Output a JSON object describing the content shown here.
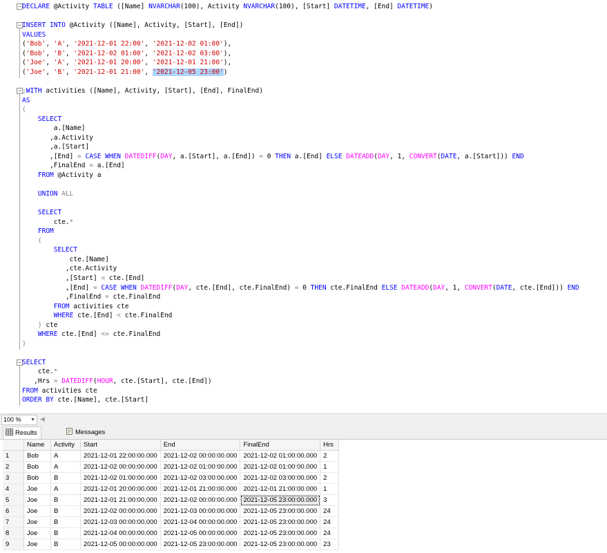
{
  "editor": {
    "lines": [
      {
        "t": [
          {
            "c": "kw",
            "s": "DECLARE"
          },
          {
            "s": " @Activity "
          },
          {
            "c": "kw",
            "s": "TABLE"
          },
          {
            "s": " ([Name] "
          },
          {
            "c": "kw",
            "s": "NVARCHAR"
          },
          {
            "s": "(100), Activity "
          },
          {
            "c": "kw",
            "s": "NVARCHAR"
          },
          {
            "s": "(100), [Start] "
          },
          {
            "c": "kw",
            "s": "DATETIME"
          },
          {
            "s": ", [End] "
          },
          {
            "c": "kw",
            "s": "DATETIME"
          },
          {
            "s": ")"
          }
        ]
      },
      {
        "t": []
      },
      {
        "t": [
          {
            "c": "kw",
            "s": "INSERT INTO"
          },
          {
            "s": " @Activity ([Name], Activity, [Start], [End])"
          }
        ]
      },
      {
        "t": [
          {
            "c": "kw",
            "s": "VALUES"
          }
        ]
      },
      {
        "t": [
          {
            "s": "("
          },
          {
            "c": "str",
            "s": "'Bob'"
          },
          {
            "s": ", "
          },
          {
            "c": "str",
            "s": "'A'"
          },
          {
            "s": ", "
          },
          {
            "c": "str",
            "s": "'2021-12-01 22:00'"
          },
          {
            "s": ", "
          },
          {
            "c": "str",
            "s": "'2021-12-02 01:00'"
          },
          {
            "s": "),"
          }
        ]
      },
      {
        "t": [
          {
            "s": "("
          },
          {
            "c": "str",
            "s": "'Bob'"
          },
          {
            "s": ", "
          },
          {
            "c": "str",
            "s": "'B'"
          },
          {
            "s": ", "
          },
          {
            "c": "str",
            "s": "'2021-12-02 01:00'"
          },
          {
            "s": ", "
          },
          {
            "c": "str",
            "s": "'2021-12-02 03:00'"
          },
          {
            "s": "),"
          }
        ]
      },
      {
        "t": [
          {
            "s": "("
          },
          {
            "c": "str",
            "s": "'Joe'"
          },
          {
            "s": ", "
          },
          {
            "c": "str",
            "s": "'A'"
          },
          {
            "s": ", "
          },
          {
            "c": "str",
            "s": "'2021-12-01 20:00'"
          },
          {
            "s": ", "
          },
          {
            "c": "str",
            "s": "'2021-12-01 21:00'"
          },
          {
            "s": "),"
          }
        ]
      },
      {
        "t": [
          {
            "s": "("
          },
          {
            "c": "str",
            "s": "'Joe'"
          },
          {
            "s": ", "
          },
          {
            "c": "str",
            "s": "'B'"
          },
          {
            "s": ", "
          },
          {
            "c": "str",
            "s": "'2021-12-01 21:00'"
          },
          {
            "s": ", "
          },
          {
            "c": "str sel",
            "s": "'2021-12-05 23:00'"
          },
          {
            "s": ")"
          }
        ]
      },
      {
        "t": []
      },
      {
        "t": [
          {
            "c": "gray",
            "s": ";"
          },
          {
            "c": "kw",
            "s": "WITH"
          },
          {
            "s": " activities ([Name], Activity, [Start], [End], FinalEnd)"
          }
        ]
      },
      {
        "t": [
          {
            "c": "kw",
            "s": "AS"
          }
        ]
      },
      {
        "t": [
          {
            "c": "gray",
            "s": "("
          }
        ]
      },
      {
        "t": [
          {
            "s": "    "
          },
          {
            "c": "kw",
            "s": "SELECT"
          }
        ]
      },
      {
        "t": [
          {
            "s": "        a.[Name]"
          }
        ]
      },
      {
        "t": [
          {
            "s": "       ,a.Activity"
          }
        ]
      },
      {
        "t": [
          {
            "s": "       ,a.[Start]"
          }
        ]
      },
      {
        "t": [
          {
            "s": "       ,[End] "
          },
          {
            "c": "gray",
            "s": "="
          },
          {
            "s": " "
          },
          {
            "c": "kw",
            "s": "CASE WHEN"
          },
          {
            "s": " "
          },
          {
            "c": "fn",
            "s": "DATEDIFF"
          },
          {
            "s": "("
          },
          {
            "c": "fn",
            "s": "DAY"
          },
          {
            "s": ", a.[Start], a.[End]) "
          },
          {
            "c": "gray",
            "s": "="
          },
          {
            "s": " 0 "
          },
          {
            "c": "kw",
            "s": "THEN"
          },
          {
            "s": " a.[End] "
          },
          {
            "c": "kw",
            "s": "ELSE"
          },
          {
            "s": " "
          },
          {
            "c": "fn",
            "s": "DATEADD"
          },
          {
            "s": "("
          },
          {
            "c": "fn",
            "s": "DAY"
          },
          {
            "s": ", 1, "
          },
          {
            "c": "fn",
            "s": "CONVERT"
          },
          {
            "s": "("
          },
          {
            "c": "kw",
            "s": "DATE"
          },
          {
            "s": ", a.[Start])) "
          },
          {
            "c": "kw",
            "s": "END"
          }
        ]
      },
      {
        "t": [
          {
            "s": "       ,FinalEnd "
          },
          {
            "c": "gray",
            "s": "="
          },
          {
            "s": " a.[End]"
          }
        ]
      },
      {
        "t": [
          {
            "s": "    "
          },
          {
            "c": "kw",
            "s": "FROM"
          },
          {
            "s": " @Activity a"
          }
        ]
      },
      {
        "t": []
      },
      {
        "t": [
          {
            "s": "    "
          },
          {
            "c": "kw",
            "s": "UNION"
          },
          {
            "s": " "
          },
          {
            "c": "gray",
            "s": "ALL"
          }
        ]
      },
      {
        "t": []
      },
      {
        "t": [
          {
            "s": "    "
          },
          {
            "c": "kw",
            "s": "SELECT"
          }
        ]
      },
      {
        "t": [
          {
            "s": "        cte."
          },
          {
            "c": "gray",
            "s": "*"
          }
        ]
      },
      {
        "t": [
          {
            "s": "    "
          },
          {
            "c": "kw",
            "s": "FROM"
          }
        ]
      },
      {
        "t": [
          {
            "s": "    "
          },
          {
            "c": "gray",
            "s": "("
          }
        ]
      },
      {
        "t": [
          {
            "s": "        "
          },
          {
            "c": "kw",
            "s": "SELECT"
          }
        ]
      },
      {
        "t": [
          {
            "s": "            cte.[Name]"
          }
        ]
      },
      {
        "t": [
          {
            "s": "           ,cte.Activity"
          }
        ]
      },
      {
        "t": [
          {
            "s": "           ,[Start] "
          },
          {
            "c": "gray",
            "s": "="
          },
          {
            "s": " cte.[End]"
          }
        ]
      },
      {
        "t": [
          {
            "s": "           ,[End] "
          },
          {
            "c": "gray",
            "s": "="
          },
          {
            "s": " "
          },
          {
            "c": "kw",
            "s": "CASE WHEN"
          },
          {
            "s": " "
          },
          {
            "c": "fn",
            "s": "DATEDIFF"
          },
          {
            "s": "("
          },
          {
            "c": "fn",
            "s": "DAY"
          },
          {
            "s": ", cte.[End], cte.FinalEnd) "
          },
          {
            "c": "gray",
            "s": "="
          },
          {
            "s": " 0 "
          },
          {
            "c": "kw",
            "s": "THEN"
          },
          {
            "s": " cte.FinalEnd "
          },
          {
            "c": "kw",
            "s": "ELSE"
          },
          {
            "s": " "
          },
          {
            "c": "fn",
            "s": "DATEADD"
          },
          {
            "s": "("
          },
          {
            "c": "fn",
            "s": "DAY"
          },
          {
            "s": ", 1, "
          },
          {
            "c": "fn",
            "s": "CONVERT"
          },
          {
            "s": "("
          },
          {
            "c": "kw",
            "s": "DATE"
          },
          {
            "s": ", cte.[End])) "
          },
          {
            "c": "kw",
            "s": "END"
          }
        ]
      },
      {
        "t": [
          {
            "s": "           ,FinalEnd "
          },
          {
            "c": "gray",
            "s": "="
          },
          {
            "s": " cte.FinalEnd"
          }
        ]
      },
      {
        "t": [
          {
            "s": "        "
          },
          {
            "c": "kw",
            "s": "FROM"
          },
          {
            "s": " activities cte"
          }
        ]
      },
      {
        "t": [
          {
            "s": "        "
          },
          {
            "c": "kw",
            "s": "WHERE"
          },
          {
            "s": " cte.[End] "
          },
          {
            "c": "gray",
            "s": "<"
          },
          {
            "s": " cte.FinalEnd"
          }
        ]
      },
      {
        "t": [
          {
            "s": "    "
          },
          {
            "c": "gray",
            "s": ")"
          },
          {
            "s": " cte"
          }
        ]
      },
      {
        "t": [
          {
            "s": "    "
          },
          {
            "c": "kw",
            "s": "WHERE"
          },
          {
            "s": " cte.[End] "
          },
          {
            "c": "gray",
            "s": "<="
          },
          {
            "s": " cte.FinalEnd"
          }
        ]
      },
      {
        "t": [
          {
            "c": "gray",
            "s": ")"
          }
        ]
      },
      {
        "t": []
      },
      {
        "t": [
          {
            "c": "kw",
            "s": "SELECT"
          }
        ]
      },
      {
        "t": [
          {
            "s": "    cte."
          },
          {
            "c": "gray",
            "s": "*"
          }
        ]
      },
      {
        "t": [
          {
            "s": "   ,Hrs "
          },
          {
            "c": "gray",
            "s": "="
          },
          {
            "s": " "
          },
          {
            "c": "fn",
            "s": "DATEDIFF"
          },
          {
            "s": "("
          },
          {
            "c": "fn",
            "s": "HOUR"
          },
          {
            "s": ", cte.[Start], cte.[End])"
          }
        ]
      },
      {
        "t": [
          {
            "c": "kw",
            "s": "FROM"
          },
          {
            "s": " activities cte"
          }
        ]
      },
      {
        "t": [
          {
            "c": "kw",
            "s": "ORDER BY"
          },
          {
            "s": " cte.[Name], cte.[Start]"
          }
        ]
      }
    ]
  },
  "zoom": {
    "value": "100 %"
  },
  "results": {
    "tabs": {
      "results": "Results",
      "messages": "Messages"
    },
    "columns": [
      "Name",
      "Activity",
      "Start",
      "End",
      "FinalEnd",
      "Hrs"
    ],
    "rows": [
      {
        "n": "1",
        "c": [
          "Bob",
          "A",
          "2021-12-01 22:00:00.000",
          "2021-12-02 00:00:00.000",
          "2021-12-02 01:00:00.000",
          "2"
        ]
      },
      {
        "n": "2",
        "c": [
          "Bob",
          "A",
          "2021-12-02 00:00:00.000",
          "2021-12-02 01:00:00.000",
          "2021-12-02 01:00:00.000",
          "1"
        ]
      },
      {
        "n": "3",
        "c": [
          "Bob",
          "B",
          "2021-12-02 01:00:00.000",
          "2021-12-02 03:00:00.000",
          "2021-12-02 03:00:00.000",
          "2"
        ]
      },
      {
        "n": "4",
        "c": [
          "Joe",
          "A",
          "2021-12-01 20:00:00.000",
          "2021-12-01 21:00:00.000",
          "2021-12-01 21:00:00.000",
          "1"
        ]
      },
      {
        "n": "5",
        "c": [
          "Joe",
          "B",
          "2021-12-01 21:00:00.000",
          "2021-12-02 00:00:00.000",
          "2021-12-05 23:00:00.000",
          "3"
        ]
      },
      {
        "n": "6",
        "c": [
          "Joe",
          "B",
          "2021-12-02 00:00:00.000",
          "2021-12-03 00:00:00.000",
          "2021-12-05 23:00:00.000",
          "24"
        ]
      },
      {
        "n": "7",
        "c": [
          "Joe",
          "B",
          "2021-12-03 00:00:00.000",
          "2021-12-04 00:00:00.000",
          "2021-12-05 23:00:00.000",
          "24"
        ]
      },
      {
        "n": "8",
        "c": [
          "Joe",
          "B",
          "2021-12-04 00:00:00.000",
          "2021-12-05 00:00:00.000",
          "2021-12-05 23:00:00.000",
          "24"
        ]
      },
      {
        "n": "9",
        "c": [
          "Joe",
          "B",
          "2021-12-05 00:00:00.000",
          "2021-12-05 23:00:00.000",
          "2021-12-05 23:00:00.000",
          "23"
        ]
      }
    ]
  }
}
